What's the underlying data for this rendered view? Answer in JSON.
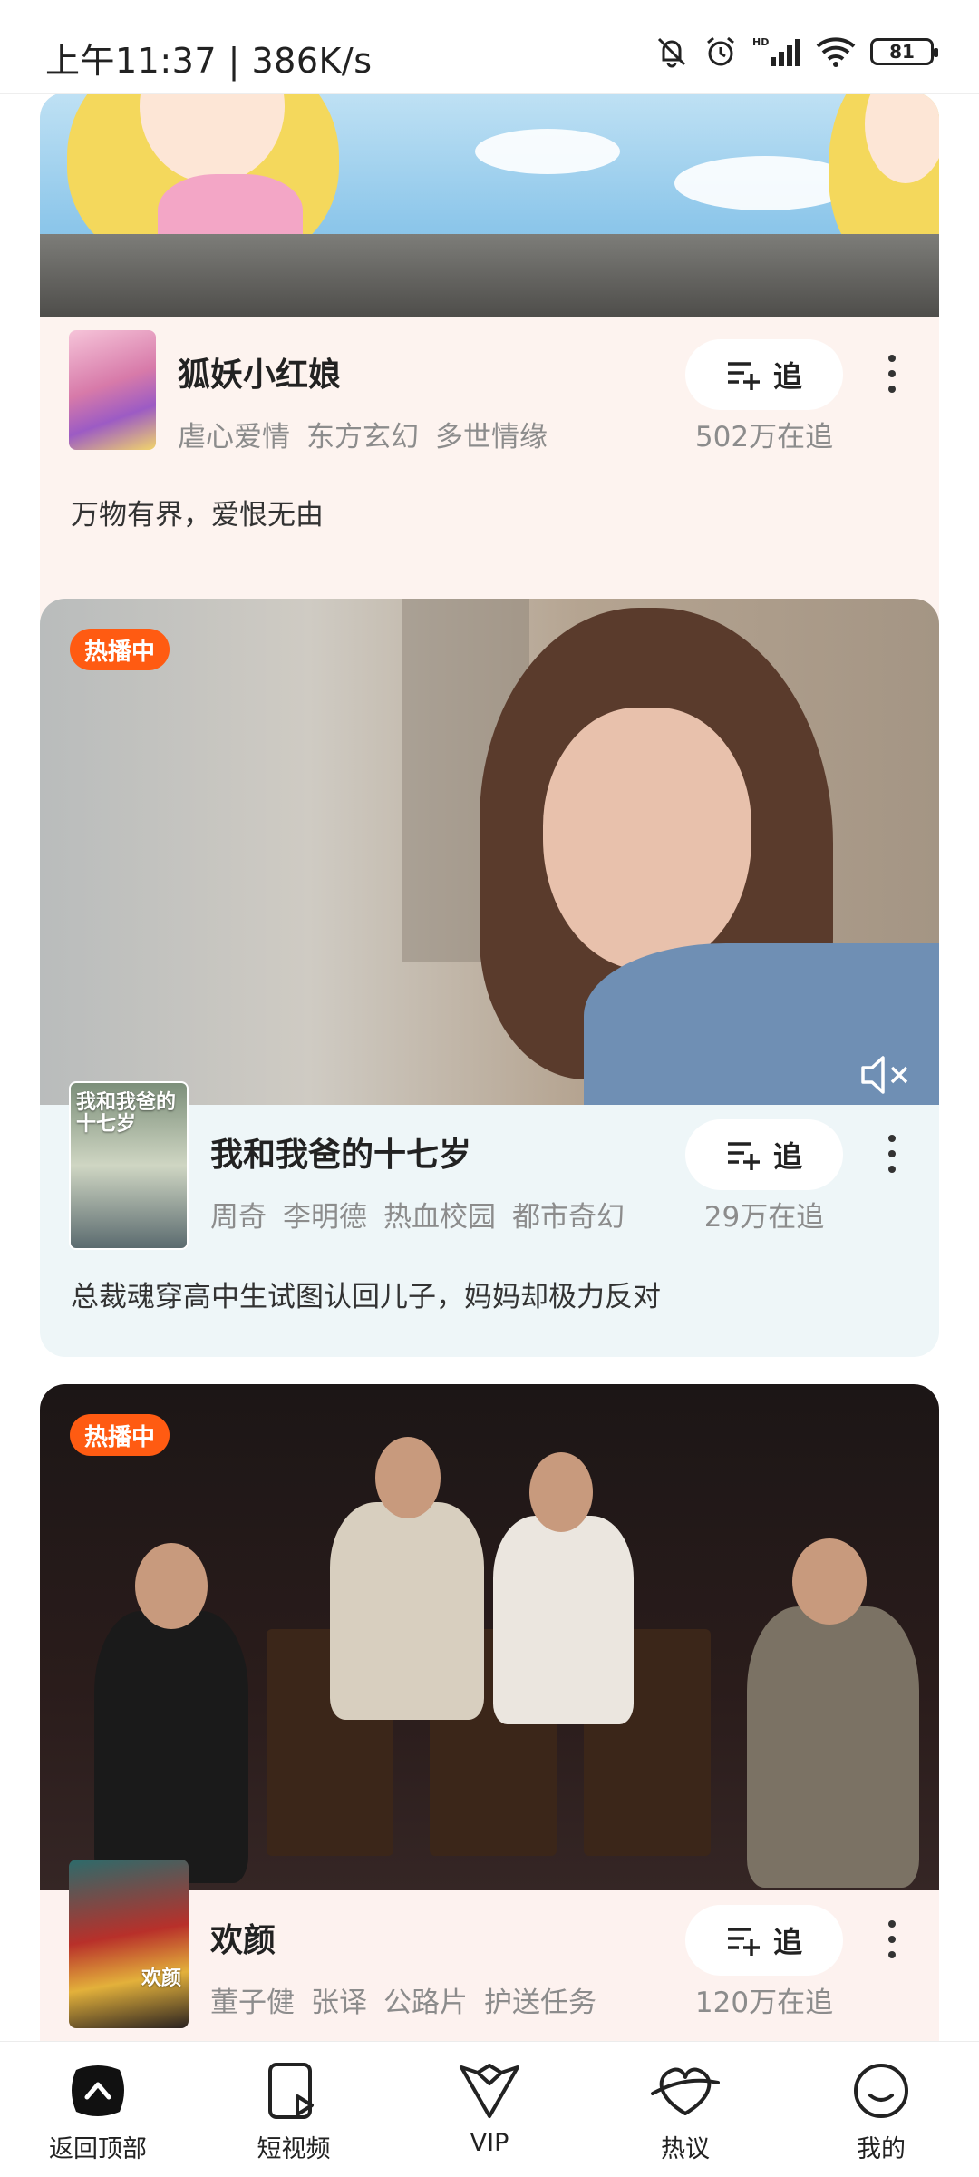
{
  "status_bar": {
    "time": "上午11:37 | 386K/s",
    "battery": "81"
  },
  "cards": [
    {
      "title": "狐妖小红娘",
      "tags": [
        "虐心爱情",
        "东方玄幻",
        "多世情缘"
      ],
      "follow_label": "追",
      "follow_count": "502万在追",
      "description": "万物有界，爱恨无由",
      "bg_color": "#fdf3ef"
    },
    {
      "badge": "热播中",
      "title": "我和我爸的十七岁",
      "poster_text": "我和我爸的十七岁",
      "tags": [
        "周奇",
        "李明德",
        "热血校园",
        "都市奇幻"
      ],
      "follow_label": "追",
      "follow_count": "29万在追",
      "description": "总裁魂穿高中生试图认回儿子，妈妈却极力反对",
      "bg_color": "#eef6f8"
    },
    {
      "badge": "热播中",
      "title": "欢颜",
      "poster_text": "欢颜",
      "tags": [
        "董子健",
        "张译",
        "公路片",
        "护送任务"
      ],
      "follow_label": "追",
      "follow_count": "120万在追",
      "bg_color": "#fdf2ef"
    }
  ],
  "bottom_nav": [
    {
      "label": "返回顶部",
      "icon": "back-to-top-icon"
    },
    {
      "label": "短视频",
      "icon": "short-video-icon"
    },
    {
      "label": "VIP",
      "icon": "vip-icon"
    },
    {
      "label": "热议",
      "icon": "hot-discussion-icon"
    },
    {
      "label": "我的",
      "icon": "profile-icon"
    }
  ],
  "colors": {
    "badge": "#ff5b12",
    "text_primary": "#222222",
    "text_secondary": "#8c8c8c"
  }
}
